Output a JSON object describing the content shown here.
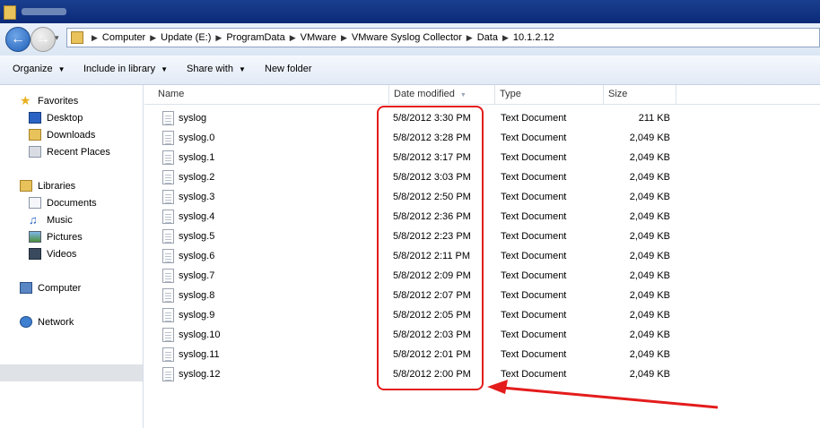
{
  "titlebar": {
    "icon": "folder-icon"
  },
  "address": {
    "segments": [
      "Computer",
      "Update (E:)",
      "ProgramData",
      "VMware",
      "VMware Syslog Collector",
      "Data",
      "10.1.2.12"
    ]
  },
  "toolbar": {
    "organize": "Organize",
    "include": "Include in library",
    "share": "Share with",
    "new_folder": "New folder"
  },
  "nav": {
    "favorites": "Favorites",
    "desktop": "Desktop",
    "downloads": "Downloads",
    "recent": "Recent Places",
    "libraries": "Libraries",
    "documents": "Documents",
    "music": "Music",
    "pictures": "Pictures",
    "videos": "Videos",
    "computer": "Computer",
    "network": "Network"
  },
  "columns": {
    "name": "Name",
    "date": "Date modified",
    "type": "Type",
    "size": "Size"
  },
  "files": [
    {
      "name": "syslog",
      "date": "5/8/2012 3:30 PM",
      "type": "Text Document",
      "size": "211 KB"
    },
    {
      "name": "syslog.0",
      "date": "5/8/2012 3:28 PM",
      "type": "Text Document",
      "size": "2,049 KB"
    },
    {
      "name": "syslog.1",
      "date": "5/8/2012 3:17 PM",
      "type": "Text Document",
      "size": "2,049 KB"
    },
    {
      "name": "syslog.2",
      "date": "5/8/2012 3:03 PM",
      "type": "Text Document",
      "size": "2,049 KB"
    },
    {
      "name": "syslog.3",
      "date": "5/8/2012 2:50 PM",
      "type": "Text Document",
      "size": "2,049 KB"
    },
    {
      "name": "syslog.4",
      "date": "5/8/2012 2:36 PM",
      "type": "Text Document",
      "size": "2,049 KB"
    },
    {
      "name": "syslog.5",
      "date": "5/8/2012 2:23 PM",
      "type": "Text Document",
      "size": "2,049 KB"
    },
    {
      "name": "syslog.6",
      "date": "5/8/2012 2:11 PM",
      "type": "Text Document",
      "size": "2,049 KB"
    },
    {
      "name": "syslog.7",
      "date": "5/8/2012 2:09 PM",
      "type": "Text Document",
      "size": "2,049 KB"
    },
    {
      "name": "syslog.8",
      "date": "5/8/2012 2:07 PM",
      "type": "Text Document",
      "size": "2,049 KB"
    },
    {
      "name": "syslog.9",
      "date": "5/8/2012 2:05 PM",
      "type": "Text Document",
      "size": "2,049 KB"
    },
    {
      "name": "syslog.10",
      "date": "5/8/2012 2:03 PM",
      "type": "Text Document",
      "size": "2,049 KB"
    },
    {
      "name": "syslog.11",
      "date": "5/8/2012 2:01 PM",
      "type": "Text Document",
      "size": "2,049 KB"
    },
    {
      "name": "syslog.12",
      "date": "5/8/2012 2:00 PM",
      "type": "Text Document",
      "size": "2,049 KB"
    }
  ],
  "annotation": {
    "color": "#e41c1c"
  }
}
